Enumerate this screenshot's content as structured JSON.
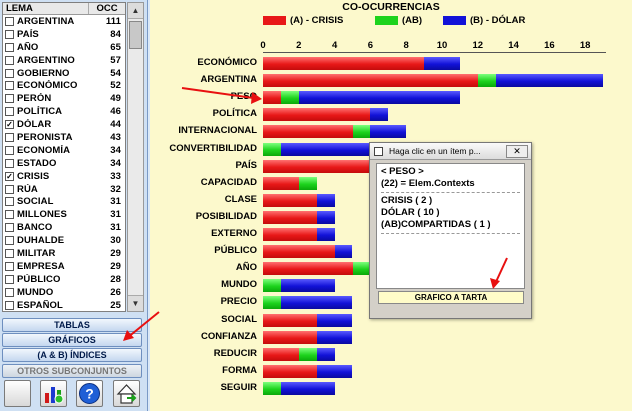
{
  "lema_table": {
    "col_lema": "LEMA",
    "col_occ": "OCC",
    "rows": [
      {
        "word": "ARGENTINA",
        "occ": "111",
        "checked": false
      },
      {
        "word": "PAÍS",
        "occ": "84",
        "checked": false
      },
      {
        "word": "AÑO",
        "occ": "65",
        "checked": false
      },
      {
        "word": "ARGENTINO",
        "occ": "57",
        "checked": false
      },
      {
        "word": "GOBIERNO",
        "occ": "54",
        "checked": false
      },
      {
        "word": "ECONÓMICO",
        "occ": "52",
        "checked": false
      },
      {
        "word": "PERÓN",
        "occ": "49",
        "checked": false
      },
      {
        "word": "POLÍTICA",
        "occ": "46",
        "checked": false
      },
      {
        "word": "DÓLAR",
        "occ": "44",
        "checked": true
      },
      {
        "word": "PERONISTA",
        "occ": "43",
        "checked": false
      },
      {
        "word": "ECONOMÍA",
        "occ": "34",
        "checked": false
      },
      {
        "word": "ESTADO",
        "occ": "34",
        "checked": false
      },
      {
        "word": "CRISIS",
        "occ": "33",
        "checked": true
      },
      {
        "word": "RÚA",
        "occ": "32",
        "checked": false
      },
      {
        "word": "SOCIAL",
        "occ": "31",
        "checked": false
      },
      {
        "word": "MILLONES",
        "occ": "31",
        "checked": false
      },
      {
        "word": "BANCO",
        "occ": "31",
        "checked": false
      },
      {
        "word": "DUHALDE",
        "occ": "30",
        "checked": false
      },
      {
        "word": "MILITAR",
        "occ": "29",
        "checked": false
      },
      {
        "word": "EMPRESA",
        "occ": "29",
        "checked": false
      },
      {
        "word": "PÚBLICO",
        "occ": "28",
        "checked": false
      },
      {
        "word": "MUNDO",
        "occ": "26",
        "checked": false
      },
      {
        "word": "ESPAÑOL",
        "occ": "25",
        "checked": false
      }
    ]
  },
  "nav": {
    "tablas": "TABLAS",
    "graficos": "GRÁFICOS",
    "indices": "(A & B)  ÍNDICES",
    "otros": "OTROS SUBCONJUNTOS"
  },
  "colors": {
    "crisis": "#e81818",
    "ab": "#1dd31d",
    "dolar": "#1212d8",
    "chart_bg": "#fcf9cc"
  },
  "chart_data": {
    "type": "bar",
    "orientation": "horizontal",
    "stacked": true,
    "title": "CO-OCURRENCIAS",
    "legend": [
      "(A) - CRISIS",
      "(AB)",
      "(B) - DÓLAR"
    ],
    "legend_position": "top",
    "x_ticks": [
      "0",
      "2",
      "4",
      "6",
      "8",
      "10",
      "12",
      "14",
      "16",
      "18"
    ],
    "xlim": [
      0,
      19
    ],
    "categories": [
      "ECONÓMICO",
      "ARGENTINA",
      "PESO",
      "POLÍTICA",
      "INTERNACIONAL",
      "CONVERTIBILIDAD",
      "PAÍS",
      "CAPACIDAD",
      "CLASE",
      "POSIBILIDAD",
      "EXTERNO",
      "PÚBLICO",
      "AÑO",
      "MUNDO",
      "PRECIO",
      "SOCIAL",
      "CONFIANZA",
      "REDUCIR",
      "FORMA",
      "SEGUIR"
    ],
    "series": [
      {
        "name": "(A) - CRISIS",
        "values": [
          9,
          12,
          1,
          6,
          5,
          0,
          6,
          2,
          3,
          3,
          3,
          4,
          5,
          0,
          0,
          3,
          3,
          2,
          3,
          0
        ]
      },
      {
        "name": "(AB)",
        "values": [
          0,
          1,
          1,
          0,
          1,
          1,
          0,
          1,
          0,
          0,
          0,
          0,
          1,
          1,
          1,
          0,
          0,
          1,
          0,
          1
        ]
      },
      {
        "name": "(B) - DÓLAR",
        "values": [
          2,
          6,
          9,
          1,
          2,
          6,
          2,
          0,
          1,
          1,
          1,
          1,
          1,
          3,
          4,
          2,
          2,
          1,
          2,
          3
        ]
      }
    ]
  },
  "popup": {
    "title": "Haga clic en un ítem p...",
    "close": "✕",
    "line1": "< PESO >",
    "line2": "(22) = Elem.Contexts",
    "line3": "CRISIS ( 2 )",
    "line4": "DÓLAR ( 10 )",
    "line5": "(AB)COMPARTIDAS ( 1 )",
    "button": "GRAFICO A TARTA"
  },
  "icons": [
    "chart-bars-icon",
    "help-icon",
    "home-icon"
  ]
}
